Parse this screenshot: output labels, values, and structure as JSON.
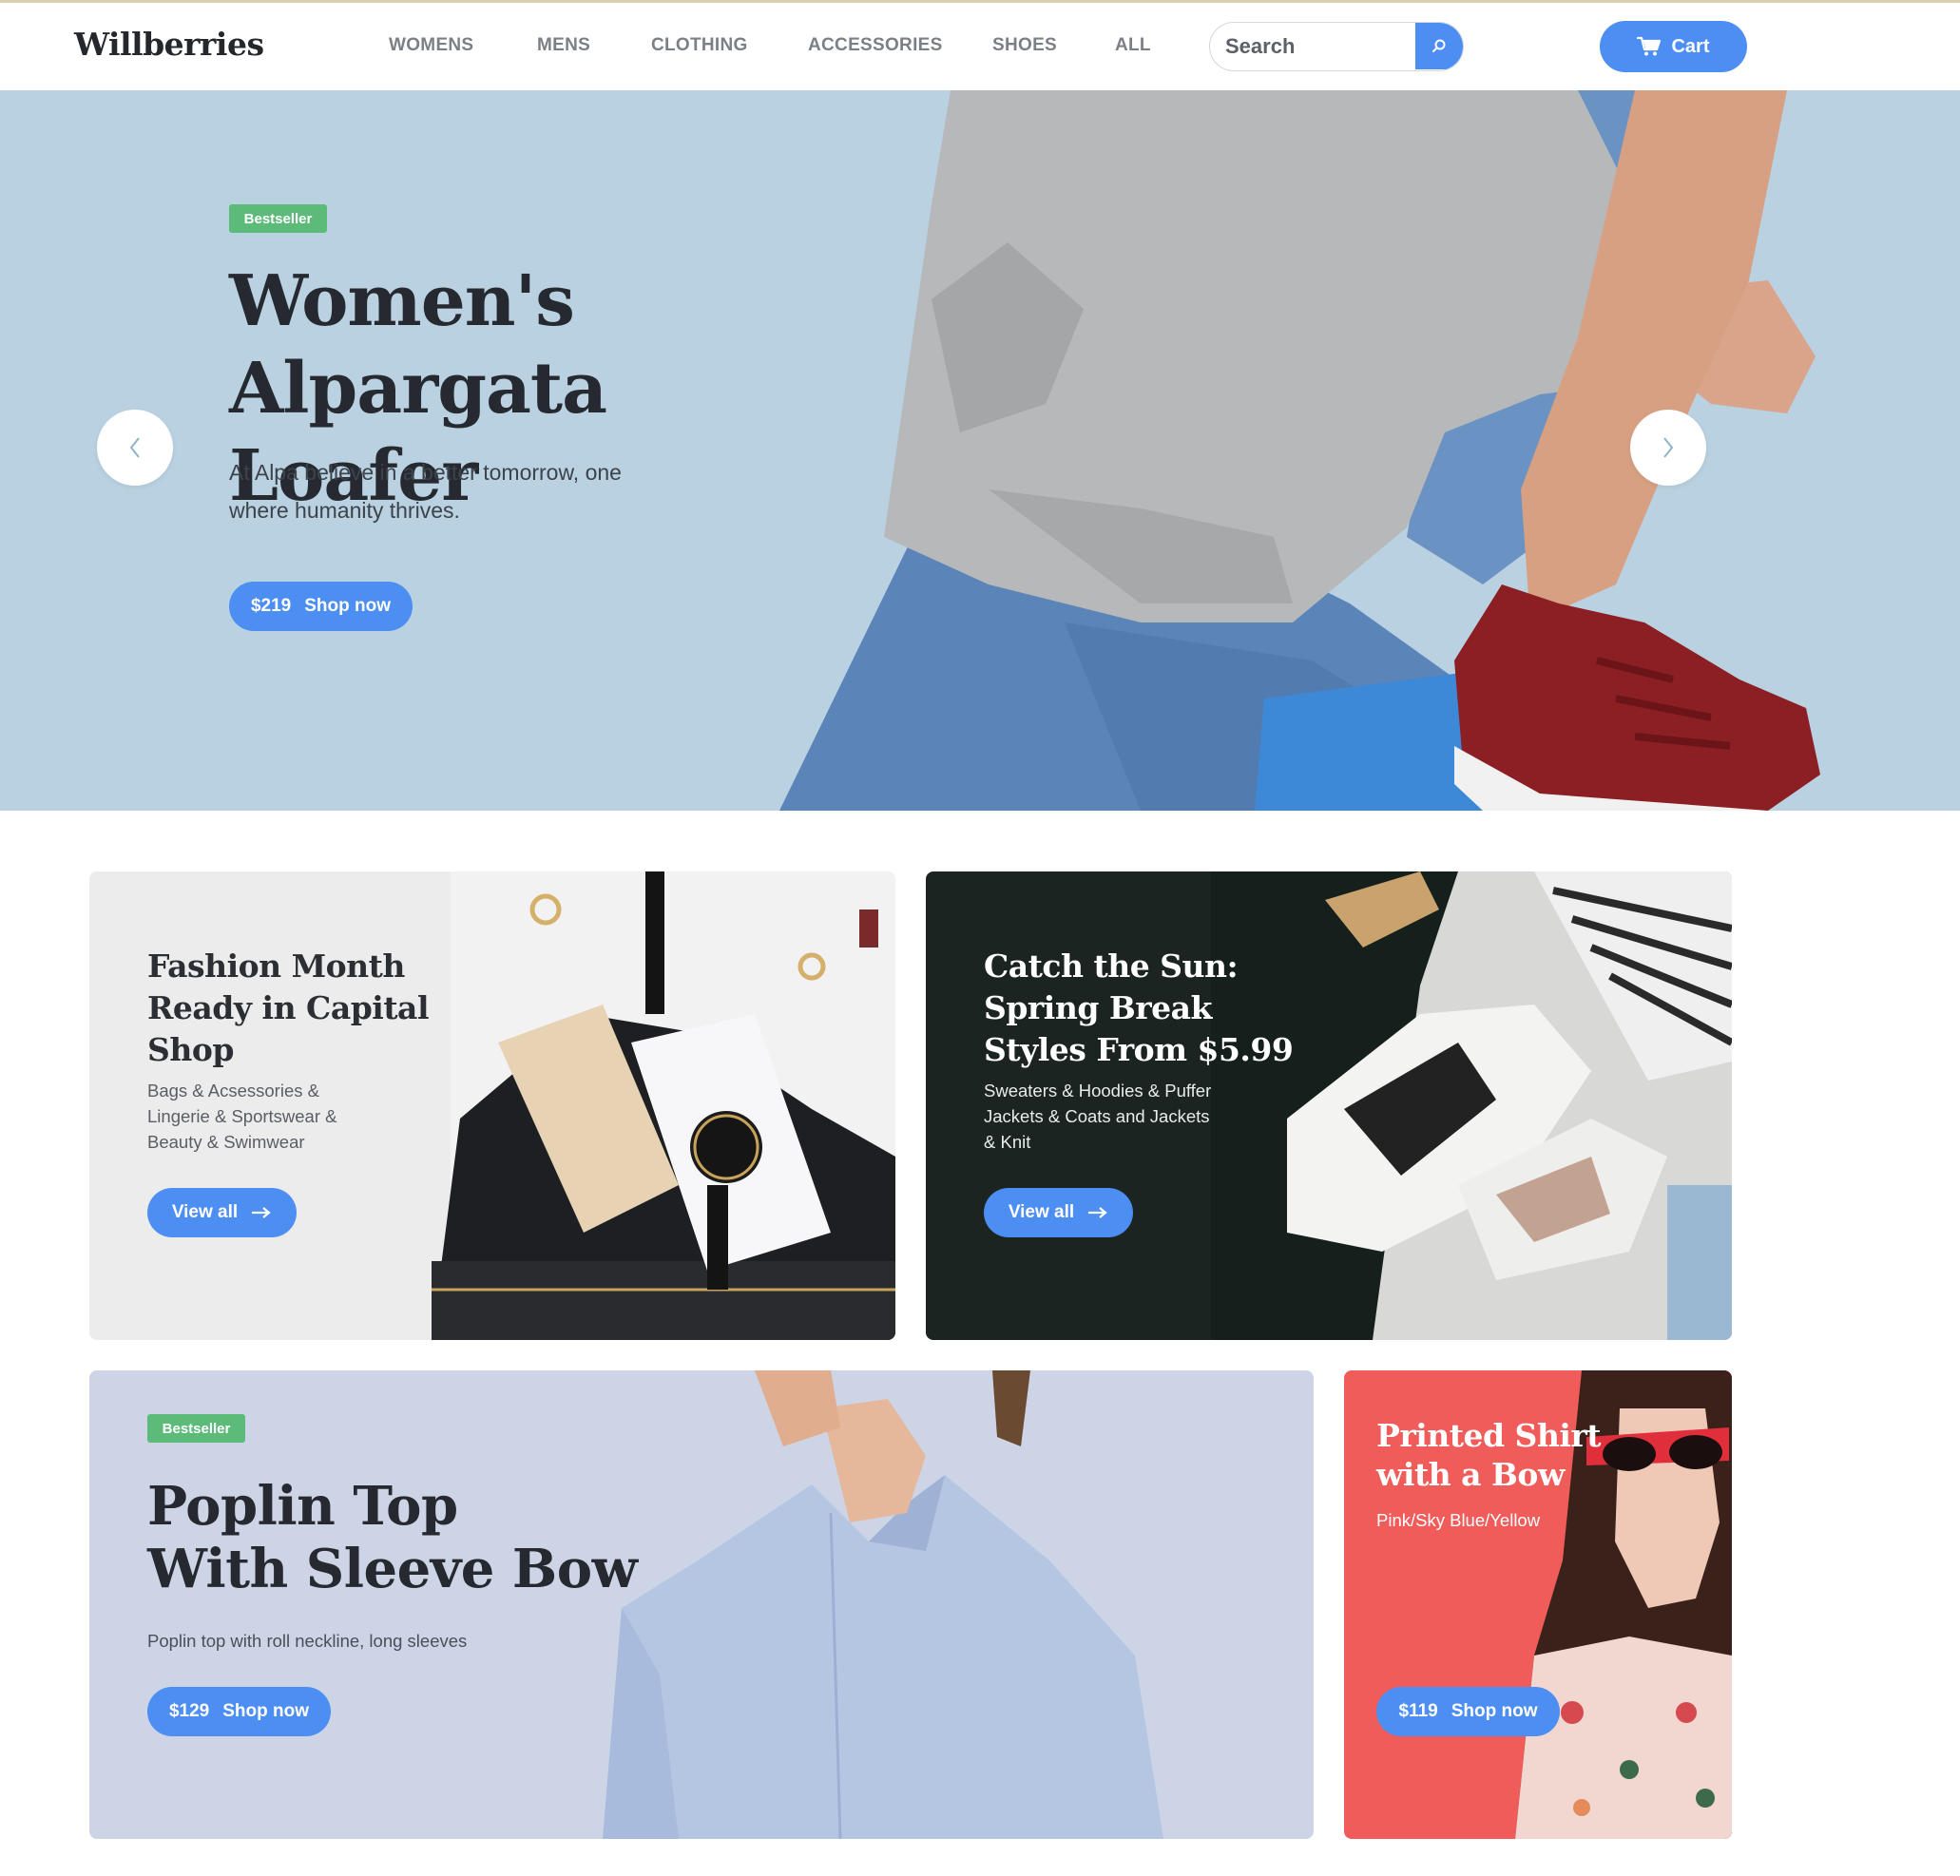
{
  "header": {
    "logo": "Willberries",
    "nav": [
      "WOMENS",
      "MENS",
      "CLOTHING",
      "ACCESSORIES",
      "SHOES",
      "ALL"
    ],
    "search_placeholder": "Search",
    "cart_label": "Cart"
  },
  "hero": {
    "badge": "Bestseller",
    "title_line1": "Women's",
    "title_line2": "Alpargata Loafer",
    "description": "At Alpa believe in a better tomorrow, one where humanity thrives.",
    "price": "$219",
    "cta": "Shop now"
  },
  "cards": {
    "fashion": {
      "title_line1": "Fashion Month",
      "title_line2": "Ready in Capital",
      "title_line3": "Shop",
      "description": "Bags & Acsessories & Lingerie & Sportswear & Beauty & Swimwear",
      "cta": "View all"
    },
    "sun": {
      "title_line1": "Catch the Sun:",
      "title_line2": "Spring Break",
      "title_line3": "Styles From $5.99",
      "description": "Sweaters & Hoodies & Puffer Jackets & Coats and Jackets & Knit",
      "cta": "View all"
    },
    "poplin": {
      "badge": "Bestseller",
      "title_line1": "Poplin Top",
      "title_line2": "With Sleeve Bow",
      "description": "Poplin top with roll neckline, long sleeves",
      "price": "$129",
      "cta": "Shop now"
    },
    "shirt": {
      "title_line1": "Printed Shirt",
      "title_line2": "with a Bow",
      "description": "Pink/Sky Blue/Yellow",
      "price": "$119",
      "cta": "Shop now"
    }
  },
  "icons": {
    "search": "search-icon",
    "cart": "cart-icon",
    "prev": "chevron-left-icon",
    "next": "chevron-right-icon",
    "arrow": "arrow-right-icon"
  },
  "colors": {
    "accent": "#4d8ef2",
    "badge": "#5dbb7a",
    "hero_bg": "#b9d1e0",
    "poplin_bg": "#cdd4e6",
    "shirt_bg": "#ef5c5a",
    "sun_bg": "#1b2421"
  }
}
